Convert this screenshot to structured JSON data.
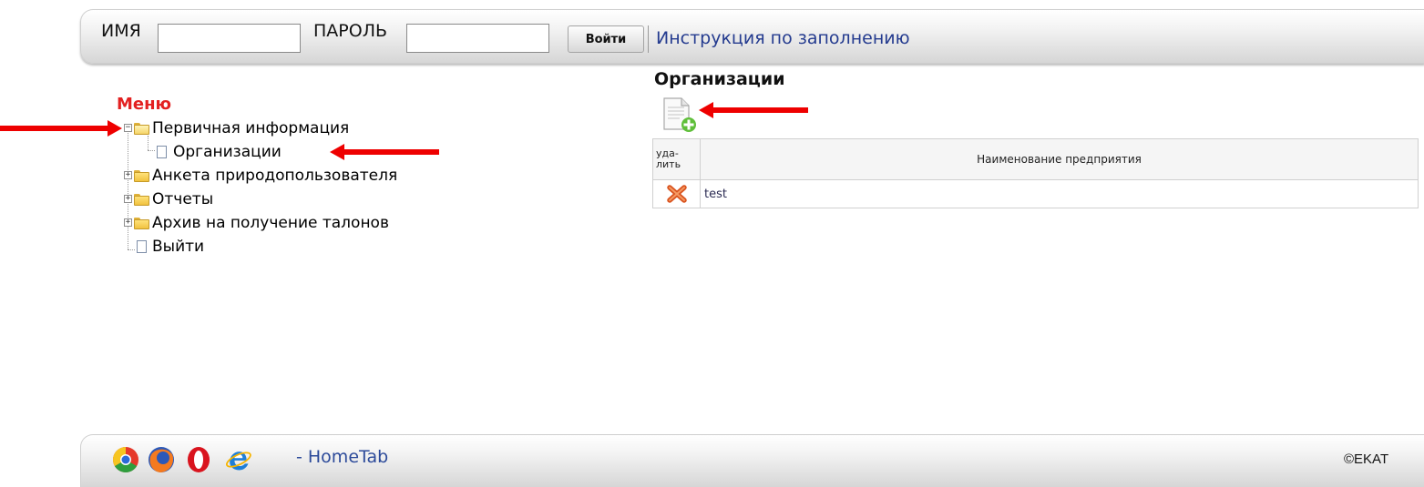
{
  "login": {
    "name_label": "ИМЯ",
    "name_value": "",
    "password_label": "ПАРОЛЬ",
    "password_value": "",
    "submit_label": "Войти",
    "help_link": "Инструкция по заполнению"
  },
  "menu": {
    "title": "Меню",
    "items": [
      {
        "label": "Первичная информация",
        "icon": "folder-open-icon",
        "expanded": true
      },
      {
        "label": "Организации",
        "icon": "document-icon"
      },
      {
        "label": "Анкета природопользователя",
        "icon": "folder-icon",
        "expanded": false
      },
      {
        "label": "Отчеты",
        "icon": "folder-icon",
        "expanded": false
      },
      {
        "label": "Архив на получение талонов",
        "icon": "folder-icon",
        "expanded": false
      },
      {
        "label": "Выйти",
        "icon": "document-icon"
      }
    ]
  },
  "content": {
    "title": "Организации",
    "add_icon": "add-document-icon",
    "table": {
      "columns": [
        "уда-\nлить",
        "Наименование предприятия"
      ],
      "rows": [
        {
          "delete_icon": "delete-x-icon",
          "name": "test"
        }
      ]
    }
  },
  "footer": {
    "browser_icons": [
      "chrome-icon",
      "firefox-icon",
      "opera-icon",
      "ie-icon"
    ],
    "hometab": "- HomeTab",
    "copyright": "©EKAT"
  },
  "colors": {
    "menu_title": "#e32121",
    "link": "#243b8f",
    "annotation_arrow": "#ee0000"
  }
}
